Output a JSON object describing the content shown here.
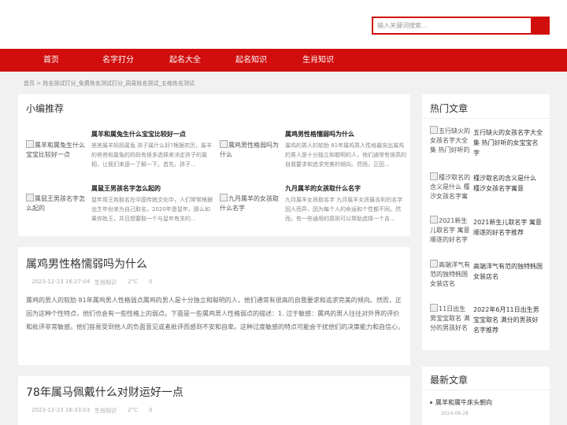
{
  "search": {
    "placeholder": "输入关键词搜索..."
  },
  "nav": [
    "首页",
    "名字打分",
    "起名大全",
    "起名知识",
    "生肖知识"
  ],
  "breadcrumb": "首页 > 姓名测试打分_免费姓名测试打分_周易姓名测试_五格姓名测试",
  "recommend": {
    "title": "小编推荐",
    "items": [
      {
        "img_alt": "属羊和属兔生什么宝宝比较好一点",
        "title": "属羊和属兔生什么宝宝比较好一点",
        "summary": "爸爸属羊妈妈属兔 孩子属什么好?根据农历，属羊的爸爸和属兔的妈妈有很多选择来决定孩子的属相，让我们来逐一了解一下。首先，孩子..."
      },
      {
        "img_alt": "属鸡男性格弱吗为什么",
        "title": "属鸡男性格懦弱吗为什么",
        "summary": "属鸡的男人的软肋 81年属鸡男人性格最突出属鸡的男人是十分独立和聪明的人，他们通常有很高的自我要求和追求完美的倾向。然而，正因..."
      },
      {
        "img_alt": "属鼠王男孩名字怎么起的",
        "title": "属鼠王男孩名字怎么起的",
        "summary": "鼠年用王姓取名在中国传统文化中，人们常常根据出生年份来为自己取名。2020年是鼠年，那么如果你姓王，并且想要取一个与鼠年有关的..."
      },
      {
        "img_alt": "九月属羊的女孩取什么名字",
        "title": "九月属羊的女孩取什么名字",
        "summary": "九月属羊女孩取名字 九月属羊女孩最吉利的名字因人而异，因为每个人的命运和个性都不同。然而，有一些通用的原则可以帮助选择一个吉..."
      }
    ]
  },
  "articles": [
    {
      "title": "属鸡男性格懦弱吗为什么",
      "date": "2023-12-23 16:27:04",
      "category": "生肖知识",
      "temp": "2°C",
      "count": "0",
      "body": "属鸡的男人的软肋 81年属鸡男人性格弱点属鸡的男人是十分独立和聪明的人，他们通常有很高的自我要求和追求完美的倾向。然而，正因为这种个性特点，他们也会有一些性格上的弱点。下面是一些属鸡男人性格弱点的描述：1. 过于敏感：属鸡的男人往往对外界的评价和批评非常敏感。他们容易受到他人的负面意见或者批评而感到不安和自卑。这种过度敏感的特点可能会干扰他们的决策能力和自信心，导致他们在人际关系和工作中..."
    },
    {
      "title": "78年属马佩戴什么对财运好一点",
      "date": "2023-12-23 16:33:03",
      "category": "生肖知识",
      "temp": "2°C",
      "count": "0"
    }
  ],
  "hot": {
    "title": "热门文章",
    "items": [
      {
        "img_alt": "五行缺火的女孩名字大全集 热门好听的女宝宝名字",
        "text": "五行缺火的女孩名字大全集 热门好听的女宝宝名字"
      },
      {
        "img_alt": "槿汐取名的含义是什么 槿汐女孩名字寓意",
        "text": "槿汐取名的含义是什么 槿汐女孩名字寓意"
      },
      {
        "img_alt": "2021新生儿取名字 寓意顺遂的好名字推荐",
        "text": "2021新生儿取名字 寓意顺遂的好名字推荐"
      },
      {
        "img_alt": "高端洋气有范的独特韩国女装店名",
        "text": "高端洋气有范的独特韩国女装店名"
      },
      {
        "img_alt": "11日出生男宝宝取名 满分的男孩好名字",
        "text": "2022年6月11日出生男宝宝取名 满分的男孩好名字推荐"
      }
    ]
  },
  "latest": {
    "title": "最新文章",
    "items": [
      {
        "title": "属羊和属牛床头朝向",
        "date": "2024-08-28"
      }
    ]
  }
}
